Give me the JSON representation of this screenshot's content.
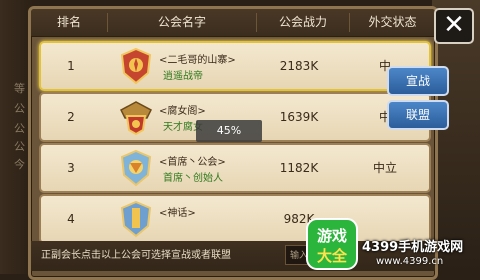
{
  "background": {
    "left_labels": [
      "等",
      "公",
      "公",
      "公",
      "今"
    ]
  },
  "header": {
    "col_rank": "排名",
    "col_name": "公会名字",
    "col_power": "公会战力",
    "col_status": "外交状态"
  },
  "rows": [
    {
      "rank": "1",
      "name": "<二毛哥的山寨>",
      "leader": "逍遥战帝",
      "power": "2183K",
      "status": "中"
    },
    {
      "rank": "2",
      "name": "<腐女阁>",
      "leader": "天才腐女",
      "power": "1639K",
      "status": "中"
    },
    {
      "rank": "3",
      "name": "<首席丶公会>",
      "leader": "首席丶创始人",
      "power": "1182K",
      "status": "中立"
    },
    {
      "rank": "4",
      "name": "<神话>",
      "leader": "",
      "power": "982K",
      "status": ""
    }
  ],
  "loading": {
    "percent": "45%"
  },
  "footer": {
    "tip": "正副会长点击以上公会可选择宣战或者联盟",
    "input_placeholder": "输入"
  },
  "actions": {
    "close": "✕",
    "declare_war": "宣战",
    "alliance": "联盟"
  },
  "watermark": {
    "logo_top": "游戏",
    "logo_bottom": "大全",
    "site_name": "4399手机游戏网",
    "site_url": "www.4399.cn"
  },
  "colors": {
    "selected_border": "#e2c23a",
    "leader_text": "#2f7a1e",
    "button_blue": "#3a72b4"
  }
}
